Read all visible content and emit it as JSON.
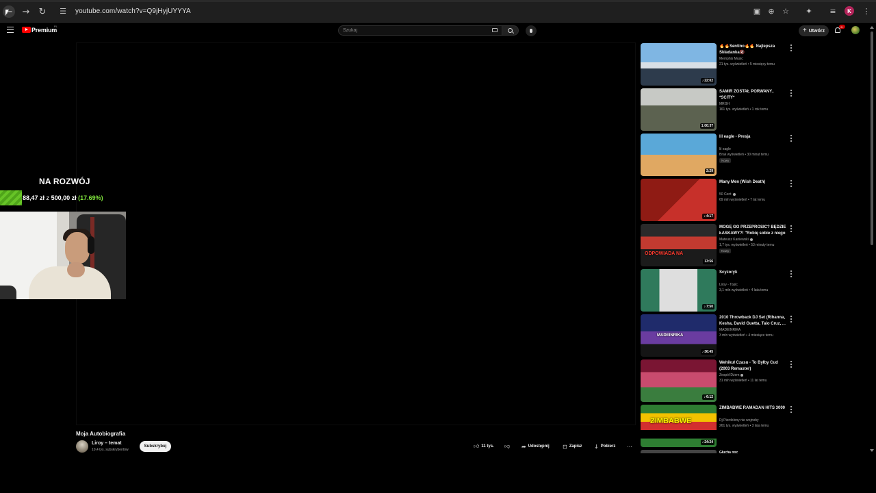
{
  "browser": {
    "url": "youtube.com/watch?v=Q9jHyjUYYYA",
    "profile_initial": "K"
  },
  "youtube": {
    "logo_text": "Premium",
    "country_code": "PL",
    "search_placeholder": "Szukaj",
    "create_label": "Utwórz",
    "notifications": "9+"
  },
  "video": {
    "title": "Moja Autobiografia",
    "channel": "Liroy – temat",
    "subscribers": "10,4 tys. subskrybentów",
    "subscribe_label": "Subskrybuj",
    "likes": "11 tys.",
    "share_label": "Udostępnij",
    "save_label": "Zapisz",
    "download_label": "Pobierz"
  },
  "overlay": {
    "title": "NA ROZWÓJ",
    "raised": "88,47 zł",
    "separator": "z",
    "goal": "500,00 zł",
    "percent_label": "(17.69%)",
    "progress_fraction": 0.1769
  },
  "recommendations": [
    {
      "title": "🔥🔥Sentino🔥🔥 Najlepsza Składanka🔇",
      "channel": "Memphis Music",
      "meta": "21 tys. wyświetleń • 5 miesięcy temu",
      "duration": "22:02",
      "thumb_text": ""
    },
    {
      "title": "SAMIR ZOSTAŁ PORWANY.. *SCITY*",
      "channel": "MRGH",
      "meta": "161 tys. wyświetleń • 1 rok temu",
      "duration": "1:00:37",
      "thumb_text": ""
    },
    {
      "title": "lil eagle - Presja",
      "channel": "lil eagle",
      "meta": "Brak wyświetleń • 30 minut temu",
      "duration": "2:29",
      "badge": "Nowy",
      "thumb_text": ""
    },
    {
      "title": "Many Men (Wish Death)",
      "channel": "50 Cent",
      "verified": true,
      "meta": "69 mln wyświetleń • 7 lat temu",
      "duration": "4:17",
      "thumb_text": ""
    },
    {
      "title": "MOGĘ GO PRZEPROSIĆ? BĘDZIE ŁASKAWY?! \"Robię sobie z niego ...",
      "channel": "Mateusz Kaniewski",
      "verified": true,
      "meta": "1,7 tys. wyświetleń • 53 minuty temu",
      "duration": "13:56",
      "badge": "Nowy",
      "thumb_text": "ODPOWIADA NA"
    },
    {
      "title": "Scyzoryk",
      "channel": "Liroy - Topic",
      "meta": "3,1 mln wyświetleń • 4 lata temu",
      "duration": "7:50",
      "thumb_text": ""
    },
    {
      "title": "2010 Throwback DJ Set (Rihanna, Kesha, David Guetta, Taio Cruz, ...",
      "channel": "MADEINRIKA",
      "meta": "3 mln wyświetleń • 4 miesiące temu",
      "duration": "36:45",
      "thumb_text": "MADEINRIKA"
    },
    {
      "title": "Wehikuł Czasu - To Byłby Cud (2003 Remaster)",
      "channel": "Zespół Dżem",
      "verified": true,
      "meta": "31 mln wyświetleń • 11 lat temu",
      "duration": "6:12",
      "thumb_text": ""
    },
    {
      "title": "ZIMBABWE RAMADAN HITS 3000",
      "channel": "Dj Pierdolony nie wojnoby",
      "meta": "261 tys. wyświetleń • 3 lata temu",
      "duration": "24:24",
      "thumb_text": "ZIMBABWE"
    }
  ],
  "partial_recommendation": {
    "title": "Głucha noc"
  }
}
